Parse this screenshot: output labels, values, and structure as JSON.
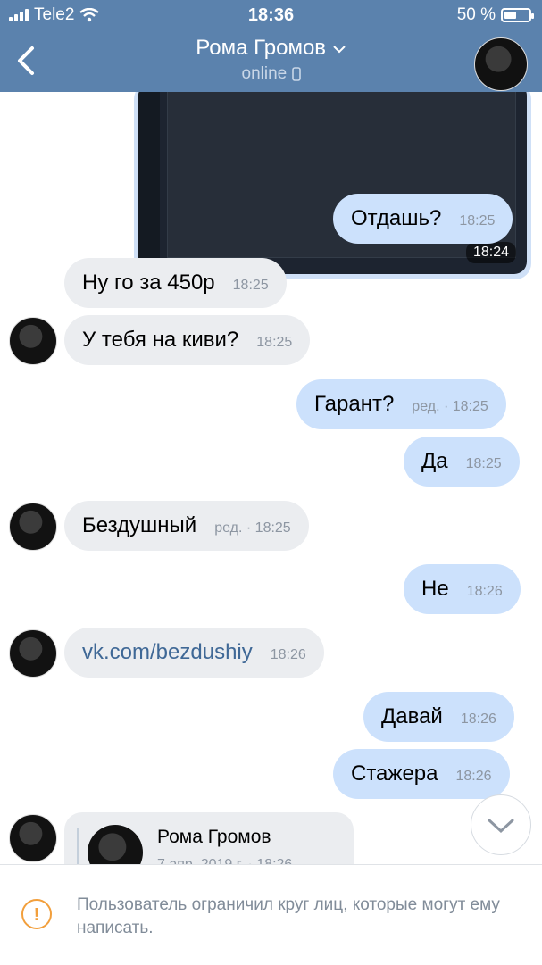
{
  "status_bar": {
    "carrier": "Tele2",
    "time": "18:36",
    "battery": "50 %",
    "battery_level": 0.5
  },
  "header": {
    "title": "Рома Громов",
    "subtitle": "online"
  },
  "image_message": {
    "time": "18:24"
  },
  "messages": [
    {
      "text": "Отдашь?",
      "time": "18:25",
      "direction": "out"
    },
    {
      "text": "Ну го за 450р",
      "time": "18:25",
      "direction": "in"
    },
    {
      "text": "У тебя на киви?",
      "time": "18:25",
      "direction": "in"
    },
    {
      "text": "Гарант?",
      "time": "ред. · 18:25",
      "direction": "out"
    },
    {
      "text": "Да",
      "time": "18:25",
      "direction": "out"
    },
    {
      "text": "Бездушный",
      "time": "ред. · 18:25",
      "direction": "in"
    },
    {
      "text": "Не",
      "time": "18:26",
      "direction": "out"
    },
    {
      "text": "vk.com/bezdushiy",
      "time": "18:26",
      "direction": "in"
    },
    {
      "text": "Давай",
      "time": "18:26",
      "direction": "out"
    },
    {
      "text": "Стажера",
      "time": "18:26",
      "direction": "out"
    }
  ],
  "forwarded": {
    "name": "Рома Громов",
    "date": "7 апр. 2019 г. · 18:26"
  },
  "footer": {
    "notice": "Пользователь ограничил круг лиц, которые могут ему написать.",
    "icon": "!"
  },
  "colors": {
    "header": "#5b82ad",
    "outgoing": "#cce1fc",
    "incoming": "#ebedf0",
    "link": "#3f6896",
    "warning": "#f29f3c"
  }
}
